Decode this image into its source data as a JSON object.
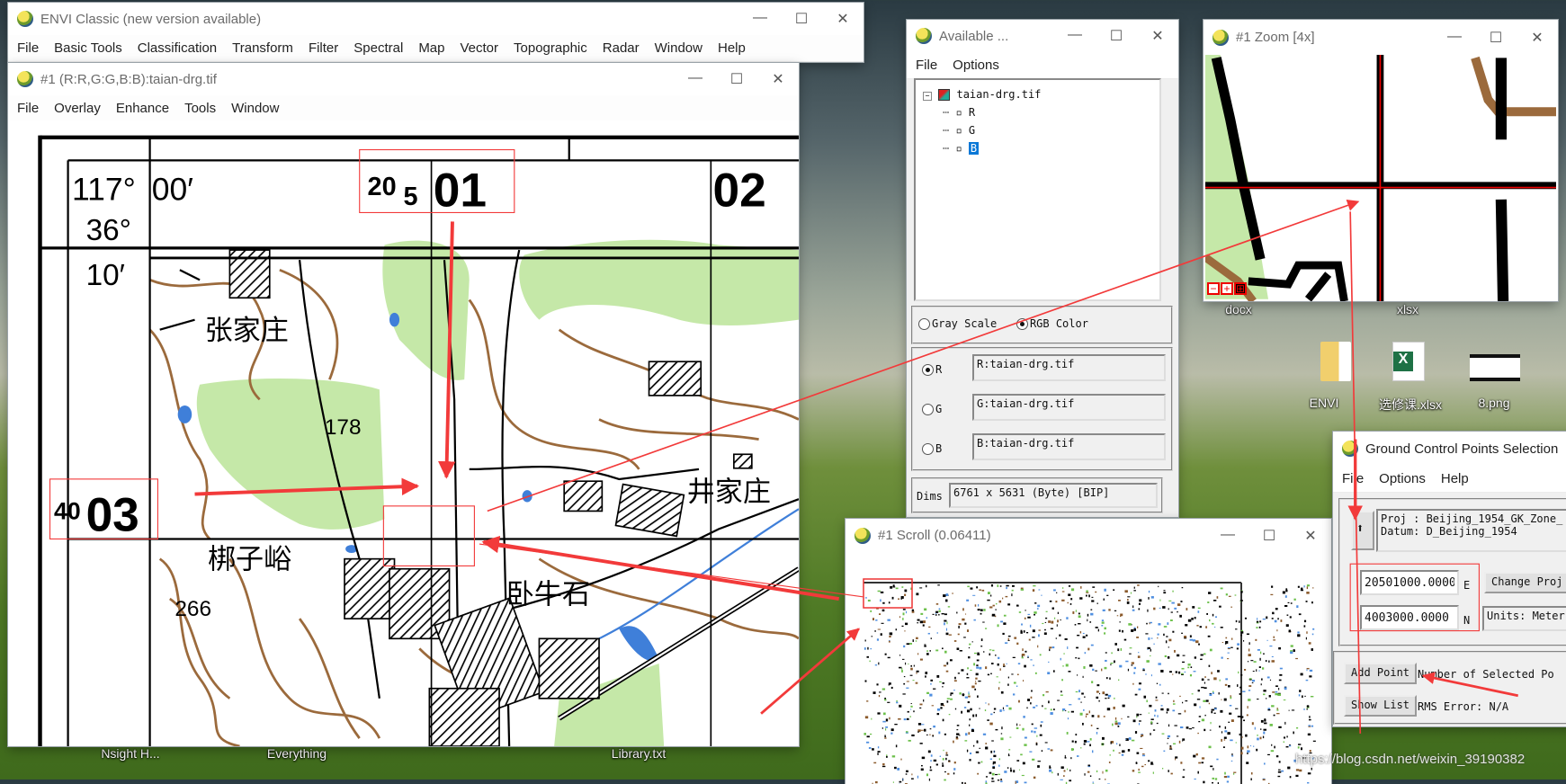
{
  "desktop": {
    "icons": [
      {
        "label": "docx"
      },
      {
        "label": "xlsx"
      },
      {
        "label": "ENVI"
      },
      {
        "label": "选修课.xlsx"
      },
      {
        "label": "8.png"
      }
    ],
    "taskbar_labels": [
      "Nsight H...",
      "Everything",
      "Library.txt"
    ],
    "watermark": "https://blog.csdn.net/weixin_39190382"
  },
  "main_window": {
    "title": "ENVI Classic (new version available)",
    "menu": [
      "File",
      "Basic Tools",
      "Classification",
      "Transform",
      "Filter",
      "Spectral",
      "Map",
      "Vector",
      "Topographic",
      "Radar",
      "Window",
      "Help"
    ]
  },
  "display_window": {
    "title": "#1 (R:R,G:G,B:B):taian-drg.tif",
    "menu": [
      "File",
      "Overlay",
      "Enhance",
      "Tools",
      "Window"
    ],
    "map_labels": {
      "lon_deg": "117°",
      "lon_min": "00′",
      "lat_deg": "36°",
      "lat_min": "10′",
      "easting_prefix": "20",
      "easting_sub": "5",
      "easting_km": "01",
      "easting_next": "02",
      "northing_prefix": "40",
      "northing_km": "03",
      "village1": "张家庄",
      "elev1": "178",
      "village2": "井家庄",
      "village3": "梆子峪",
      "elev2": "266",
      "village4": "卧牛石"
    }
  },
  "bands_window": {
    "title": "Available ...",
    "menu": [
      "File",
      "Options"
    ],
    "tree": {
      "file": "taian-drg.tif",
      "bands": [
        "R",
        "G",
        "B"
      ],
      "selected": "B"
    },
    "mode": {
      "gray": "Gray Scale",
      "rgb": "RGB Color",
      "selected": "rgb"
    },
    "channels": [
      {
        "label": "R",
        "value": "R:taian-drg.tif",
        "selected": true
      },
      {
        "label": "G",
        "value": "G:taian-drg.tif",
        "selected": false
      },
      {
        "label": "B",
        "value": "B:taian-drg.tif",
        "selected": false
      }
    ],
    "dims_label": "Dims",
    "dims_value": "6761 x 5631 (Byte) [BIP]"
  },
  "zoom_window": {
    "title": "#1 Zoom [4x]",
    "controls": [
      "−",
      "+",
      "⊞"
    ]
  },
  "scroll_window": {
    "title": "#1 Scroll (0.06411)"
  },
  "gcp_window": {
    "title": "Ground Control Points Selection",
    "menu": [
      "File",
      "Options",
      "Help"
    ],
    "proj_line": "Proj : Beijing_1954_GK_Zone_",
    "datum_line": "Datum: D_Beijing_1954",
    "easting": "20501000.0000",
    "easting_label": "E",
    "northing": "4003000.0000",
    "northing_label": "N",
    "change_proj": "Change Proj",
    "units": "Units: Meter",
    "add_point": "Add Point",
    "selected_points": "Number of Selected Po",
    "show_list": "Show List",
    "rms_error": "RMS Error: N/A"
  },
  "colors": {
    "annotation": "#f23a3a",
    "map_green": "#c5e8a8",
    "contour": "#9b6a3c",
    "water": "#3f7fd9",
    "selection": "#0a78d7"
  }
}
